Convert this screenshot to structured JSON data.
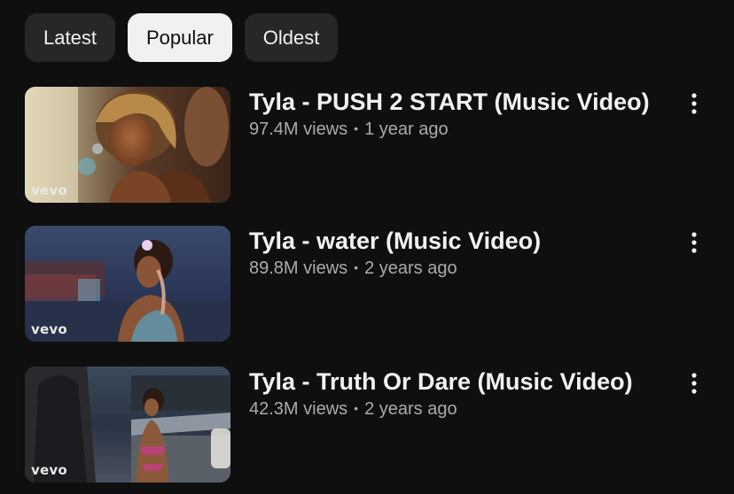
{
  "filters": {
    "chips": [
      {
        "label": "Latest"
      },
      {
        "label": "Popular"
      },
      {
        "label": "Oldest"
      }
    ],
    "selected": "Popular"
  },
  "videos": [
    {
      "title": "Tyla - PUSH 2 START (Music Video)",
      "views": "97.4M views",
      "separator": "•",
      "age": "1 year ago",
      "thumbnail_badge": "vevo",
      "more_icon": "more-vert-icon"
    },
    {
      "title": "Tyla - water (Music Video)",
      "views": "89.8M views",
      "separator": "•",
      "age": "2 years ago",
      "thumbnail_badge": "vevo",
      "more_icon": "more-vert-icon"
    },
    {
      "title": "Tyla - Truth Or Dare (Music Video)",
      "views": "42.3M views",
      "separator": "•",
      "age": "2 years ago",
      "thumbnail_badge": "vevo",
      "more_icon": "more-vert-icon"
    }
  ],
  "colors": {
    "background": "#0f0f0f",
    "chip": "#272727",
    "chip_selected": "#f1f1f1",
    "text_primary": "#f1f1f1",
    "text_secondary": "#aaaaaa"
  }
}
